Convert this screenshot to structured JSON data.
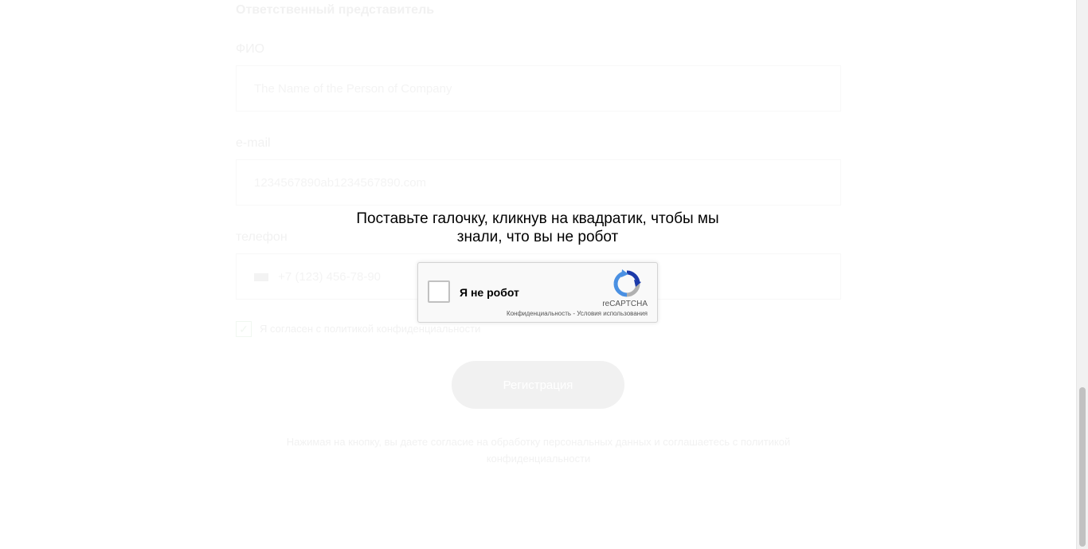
{
  "form": {
    "section_title": "Ответственный представитель",
    "name_label": "ФИО",
    "name_placeholder": "The Name of the Person of Company",
    "email_label": "e-mail",
    "email_value": "1234567890ab1234567890.com",
    "phone_label": "телефон",
    "phone_value": "+7 (123) 456-78-90",
    "consent_check": "✓",
    "consent_text": "Я согласен с политикой конфиденциальности",
    "register_label": "Регистрация",
    "legal_text": "Нажимая на кнопку, вы даете согласие на обработку персональных данных и соглашаетесь c политикой конфиденциальности"
  },
  "captcha": {
    "prompt": "Поставьте галочку, кликнув на квадратик, чтобы мы знали, что вы не робот",
    "checkbox_label": "Я не робот",
    "brand": "reCAPTCHA",
    "privacy_link": "Конфиденциальность",
    "separator": " - ",
    "terms_link": "Условия использования"
  },
  "colors": {
    "accent": "#1c3aa9",
    "logo_blue": "#4a90e2",
    "logo_gray": "#b0b0b0"
  }
}
